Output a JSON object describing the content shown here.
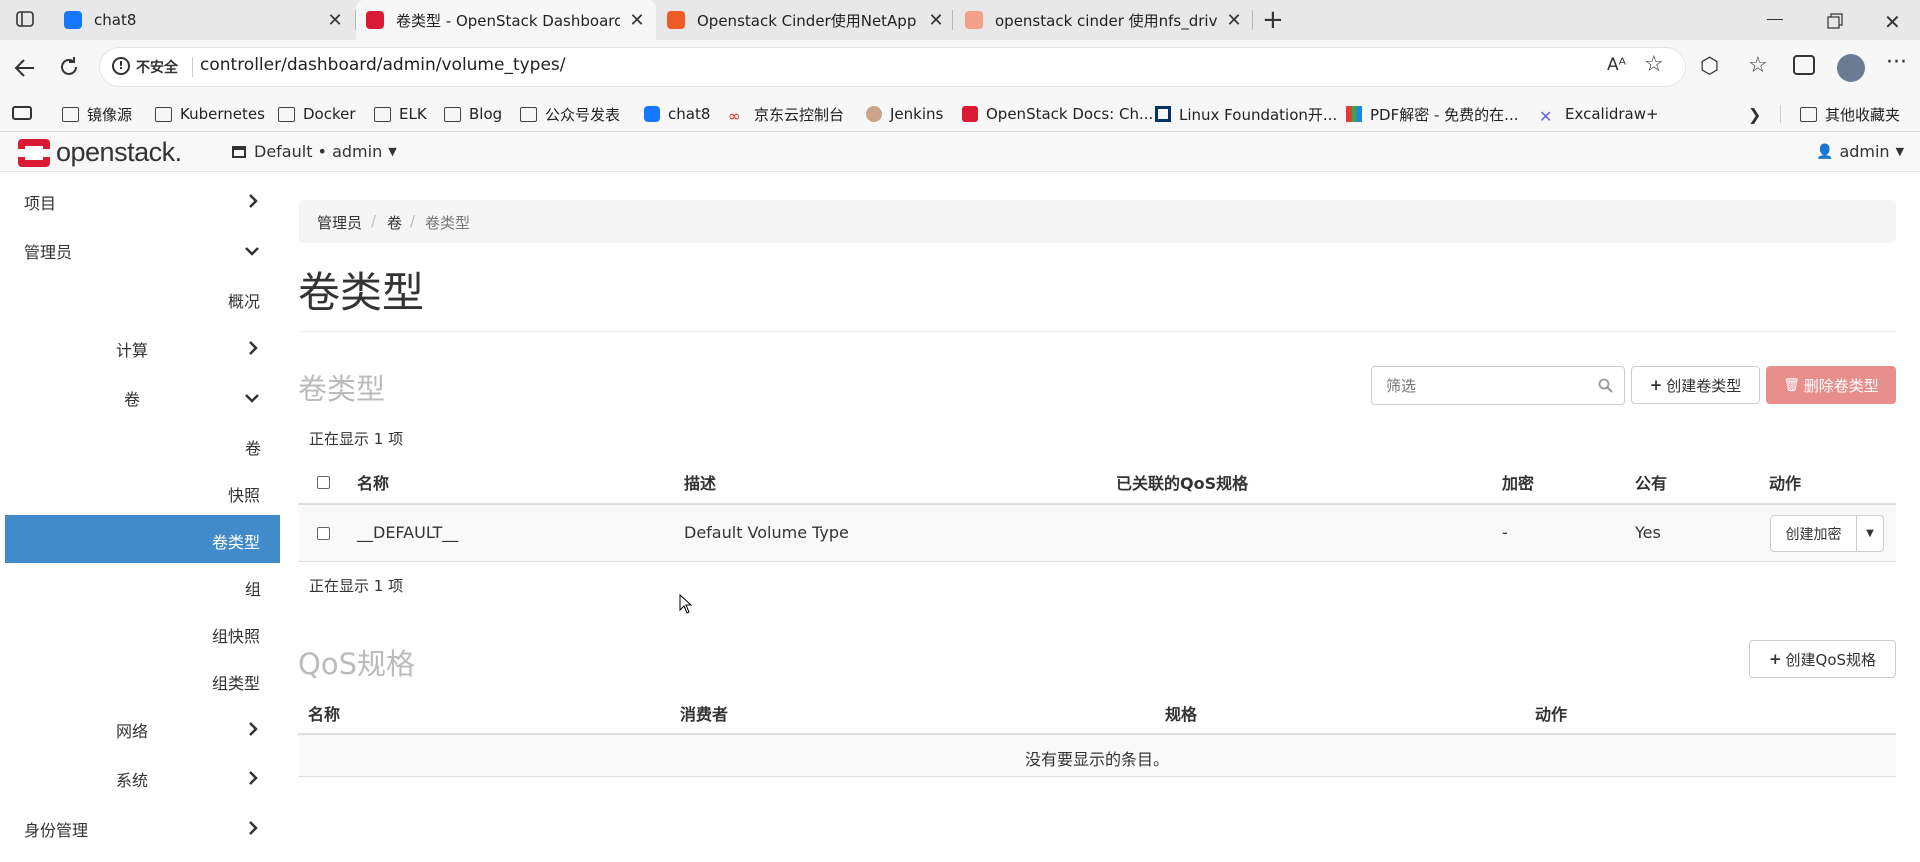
{
  "browser": {
    "tabs": [
      {
        "title": "chat8",
        "favicon_color": "#1677ff"
      },
      {
        "title": "卷类型 - OpenStack Dashboard",
        "favicon_color": "#da1a32"
      },
      {
        "title": "Openstack Cinder使用NetApp NF",
        "favicon_color": "#f05a28"
      },
      {
        "title": "openstack cinder 使用nfs_driver_r",
        "favicon_color": "#f3a08a"
      }
    ],
    "security_label": "不安全",
    "url": "controller/dashboard/admin/volume_types/",
    "bookmarks": [
      {
        "label": "镜像源",
        "icon": "folder-icon"
      },
      {
        "label": "Kubernetes",
        "icon": "folder-icon"
      },
      {
        "label": "Docker",
        "icon": "folder-icon"
      },
      {
        "label": "ELK",
        "icon": "folder-icon"
      },
      {
        "label": "Blog",
        "icon": "folder-icon"
      },
      {
        "label": "公众号发表",
        "icon": "folder-icon"
      },
      {
        "label": "chat8",
        "icon": "chat-icon"
      },
      {
        "label": "京东云控制台",
        "icon": "jdcloud-icon"
      },
      {
        "label": "Jenkins",
        "icon": "jenkins-icon"
      },
      {
        "label": "OpenStack Docs: Ch...",
        "icon": "openstack-icon"
      },
      {
        "label": "Linux Foundation开...",
        "icon": "linux-foundation-icon"
      },
      {
        "label": "PDF解密 - 免费的在...",
        "icon": "pdf-icon"
      },
      {
        "label": "Excalidraw+",
        "icon": "excalidraw-icon"
      }
    ],
    "other_bookmarks": "其他收藏夹"
  },
  "header": {
    "logo_text": "openstack.",
    "project_selector": "Default • admin",
    "user_menu": "admin"
  },
  "sidebar": {
    "project": "项目",
    "admin": "管理员",
    "overview": "概况",
    "compute": "计算",
    "volume_group": "卷",
    "volumes": "卷",
    "snapshots": "快照",
    "volume_types": "卷类型",
    "groups": "组",
    "group_snapshots": "组快照",
    "group_types": "组类型",
    "network": "网络",
    "system": "系统",
    "identity": "身份管理"
  },
  "breadcrumb": {
    "items": [
      "管理员",
      "卷",
      "卷类型"
    ]
  },
  "page_title": "卷类型",
  "volume_types_section": {
    "heading": "卷类型",
    "filter_placeholder": "筛选",
    "create_button": "创建卷类型",
    "delete_button": "删除卷类型",
    "count_text": "正在显示 1 项",
    "columns": [
      "名称",
      "描述",
      "已关联的QoS规格",
      "加密",
      "公有",
      "动作"
    ],
    "rows": [
      {
        "name": "__DEFAULT__",
        "description": "Default Volume Type",
        "qos": "",
        "encryption": "-",
        "public": "Yes",
        "action": "创建加密"
      }
    ]
  },
  "qos_section": {
    "heading": "QoS规格",
    "create_button": "创建QoS规格",
    "columns": [
      "名称",
      "消费者",
      "规格",
      "动作"
    ],
    "empty_text": "没有要显示的条目。"
  },
  "colors": {
    "primary": "#428bca",
    "danger": "#d9534f",
    "brand_red": "#da1a32"
  }
}
